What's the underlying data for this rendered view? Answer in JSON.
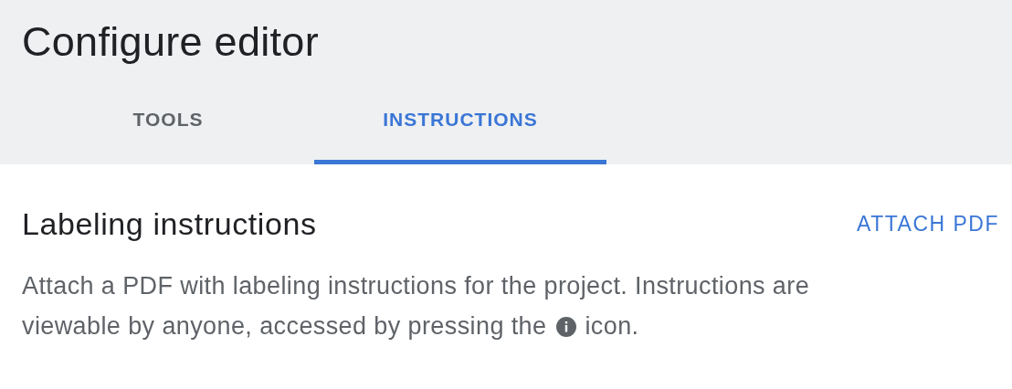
{
  "header": {
    "title": "Configure editor"
  },
  "tabs": [
    {
      "label": "TOOLS",
      "selected": false
    },
    {
      "label": "INSTRUCTIONS",
      "selected": true
    }
  ],
  "section": {
    "title": "Labeling instructions",
    "action": "ATTACH PDF",
    "description": {
      "lines": [
        "Attach a PDF with labeling instructions for the project. Instructions are",
        "viewable by anyone, accessed by pressing the"
      ],
      "after": "icon."
    }
  }
}
